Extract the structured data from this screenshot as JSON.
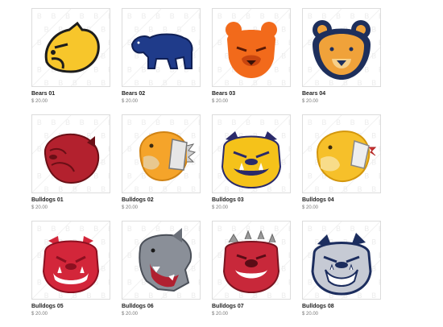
{
  "products": [
    {
      "name": "Bears 01",
      "price": "$ 20.00",
      "icon": "bear-head-yellow-icon",
      "colors": {
        "primary": "#f7c62b",
        "secondary": "#1d1d1d"
      }
    },
    {
      "name": "Bears 02",
      "price": "$ 20.00",
      "icon": "bear-walking-blue-icon",
      "colors": {
        "primary": "#1f3b8a",
        "secondary": "#0f1f55"
      }
    },
    {
      "name": "Bears 03",
      "price": "$ 20.00",
      "icon": "bear-face-orange-icon",
      "colors": {
        "primary": "#f26a1b",
        "secondary": "#c8450f"
      }
    },
    {
      "name": "Bears 04",
      "price": "$ 20.00",
      "icon": "bear-face-navy-orange-icon",
      "colors": {
        "primary": "#1e2f5c",
        "secondary": "#f0a23a"
      }
    },
    {
      "name": "Bulldogs 01",
      "price": "$ 20.00",
      "icon": "bulldog-head-red-icon",
      "colors": {
        "primary": "#b3212e",
        "secondary": "#6a0f16"
      }
    },
    {
      "name": "Bulldogs 02",
      "price": "$ 20.00",
      "icon": "bulldog-collar-gold-icon",
      "colors": {
        "primary": "#f5a42a",
        "secondary": "#d08314"
      }
    },
    {
      "name": "Bulldogs 03",
      "price": "$ 20.00",
      "icon": "bulldog-face-gold-icon",
      "colors": {
        "primary": "#f5c21a",
        "secondary": "#2a2a6a"
      }
    },
    {
      "name": "Bulldogs 04",
      "price": "$ 20.00",
      "icon": "bulldog-collar-yellow-icon",
      "colors": {
        "primary": "#f6c02a",
        "secondary": "#d3960c"
      }
    },
    {
      "name": "Bulldogs 05",
      "price": "$ 20.00",
      "icon": "bulldog-snarl-red-icon",
      "colors": {
        "primary": "#d3263a",
        "secondary": "#8c1020"
      }
    },
    {
      "name": "Bulldogs 06",
      "price": "$ 20.00",
      "icon": "bulldog-roar-gray-icon",
      "colors": {
        "primary": "#8a8f98",
        "secondary": "#b02030"
      }
    },
    {
      "name": "Bulldogs 07",
      "price": "$ 20.00",
      "icon": "bulldog-spiked-red-icon",
      "colors": {
        "primary": "#c8283a",
        "secondary": "#9a9a9a"
      }
    },
    {
      "name": "Bulldogs 08",
      "price": "$ 20.00",
      "icon": "bulldog-snarl-navy-icon",
      "colors": {
        "primary": "#c6cad4",
        "secondary": "#1c2d5e"
      }
    }
  ]
}
